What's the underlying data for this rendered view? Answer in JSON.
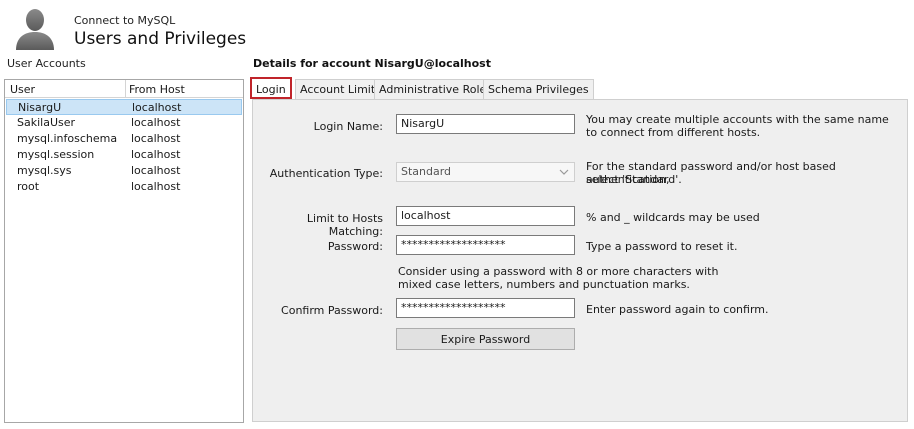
{
  "header": {
    "subtitle": "Connect to MySQL",
    "title": "Users and Privileges",
    "icon": "user-silhouette-icon"
  },
  "accounts": {
    "label": "User Accounts",
    "columns": [
      "User",
      "From Host"
    ],
    "rows": [
      {
        "user": "NisargU",
        "host": "localhost",
        "selected": true
      },
      {
        "user": "SakilaUser",
        "host": "localhost"
      },
      {
        "user": "mysql.infoschema",
        "host": "localhost"
      },
      {
        "user": "mysql.session",
        "host": "localhost"
      },
      {
        "user": "mysql.sys",
        "host": "localhost"
      },
      {
        "user": "root",
        "host": "localhost"
      }
    ]
  },
  "details": {
    "title": "Details for account NisargU@localhost",
    "tabs": [
      "Login",
      "Account Limits",
      "Administrative Roles",
      "Schema Privileges"
    ],
    "active_tab": "Login"
  },
  "form": {
    "login_name_label": "Login Name:",
    "login_name_value": "NisargU",
    "login_name_hint_1": "You may create multiple accounts with the same name",
    "login_name_hint_2": "to connect from different hosts.",
    "auth_type_label": "Authentication Type:",
    "auth_type_value": "Standard",
    "auth_hint_1": "For the standard password and/or host based authentication,",
    "auth_hint_2": "select 'Standard'.",
    "hosts_label": "Limit to Hosts Matching:",
    "hosts_value": "localhost",
    "hosts_hint": "% and _ wildcards may be used",
    "password_label": "Password:",
    "password_value": "*******************",
    "password_hint": "Type a password to reset it.",
    "password_advice_1": "Consider using a password with 8 or more characters with",
    "password_advice_2": "mixed case letters, numbers and punctuation marks.",
    "confirm_label": "Confirm Password:",
    "confirm_value": "*******************",
    "confirm_hint": "Enter password again to confirm.",
    "expire_button": "Expire Password"
  },
  "colors": {
    "selection_bg": "#cce4f7",
    "active_tab_border": "#c0242a",
    "panel_bg": "#efefef"
  }
}
